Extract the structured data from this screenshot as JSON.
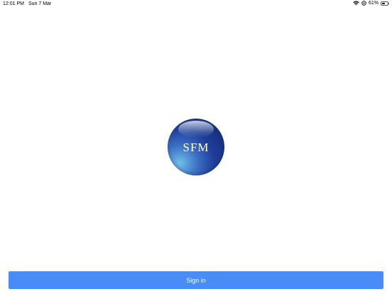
{
  "status_bar": {
    "time": "12:01 PM",
    "date": "Sun 7 Mar",
    "battery_percent_label": "61%",
    "battery_level": 0.61,
    "icons": [
      "wifi-icon",
      "location-icon",
      "battery-icon"
    ]
  },
  "logo": {
    "text": "SFM",
    "colors": {
      "primary": "#1d3d98",
      "light": "#6fbfe8"
    }
  },
  "actions": {
    "sign_in_label": "Sign in",
    "button_color": "#4a8cf5"
  }
}
